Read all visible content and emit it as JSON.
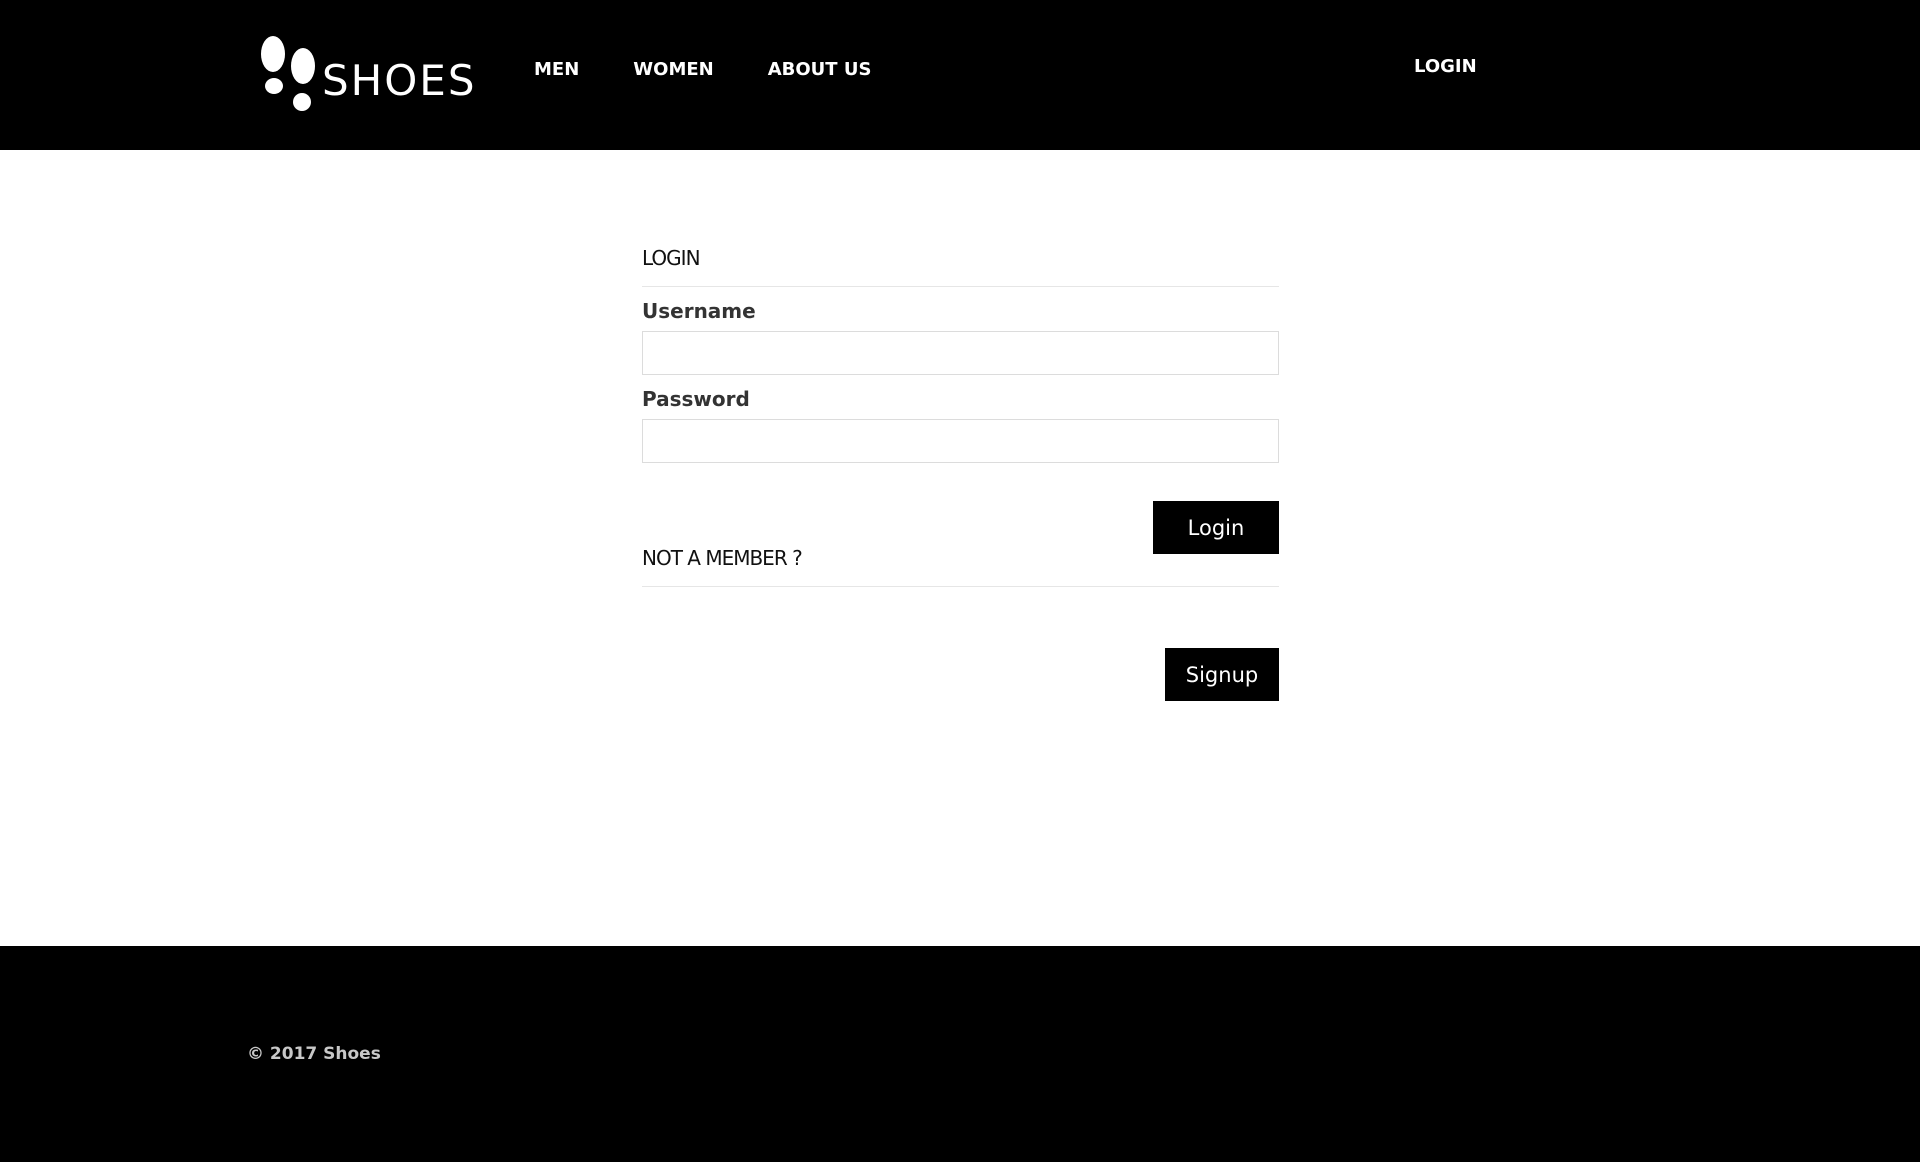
{
  "header": {
    "logo_text": "SHOES",
    "logo_icon": "footprints-icon",
    "nav": [
      {
        "label": "MEN"
      },
      {
        "label": "WOMEN"
      },
      {
        "label": "ABOUT US"
      }
    ],
    "login_link": "LOGIN"
  },
  "login_form": {
    "heading": "LOGIN",
    "username_label": "Username",
    "username_value": "",
    "password_label": "Password",
    "password_value": "",
    "login_button": "Login"
  },
  "signup": {
    "heading": "NOT A MEMBER ?",
    "signup_button": "Signup"
  },
  "footer": {
    "copyright": "© 2017 Shoes"
  },
  "colors": {
    "header_bg": "#000000",
    "footer_bg": "#000000",
    "button_bg": "#000000",
    "button_text": "#ffffff"
  }
}
